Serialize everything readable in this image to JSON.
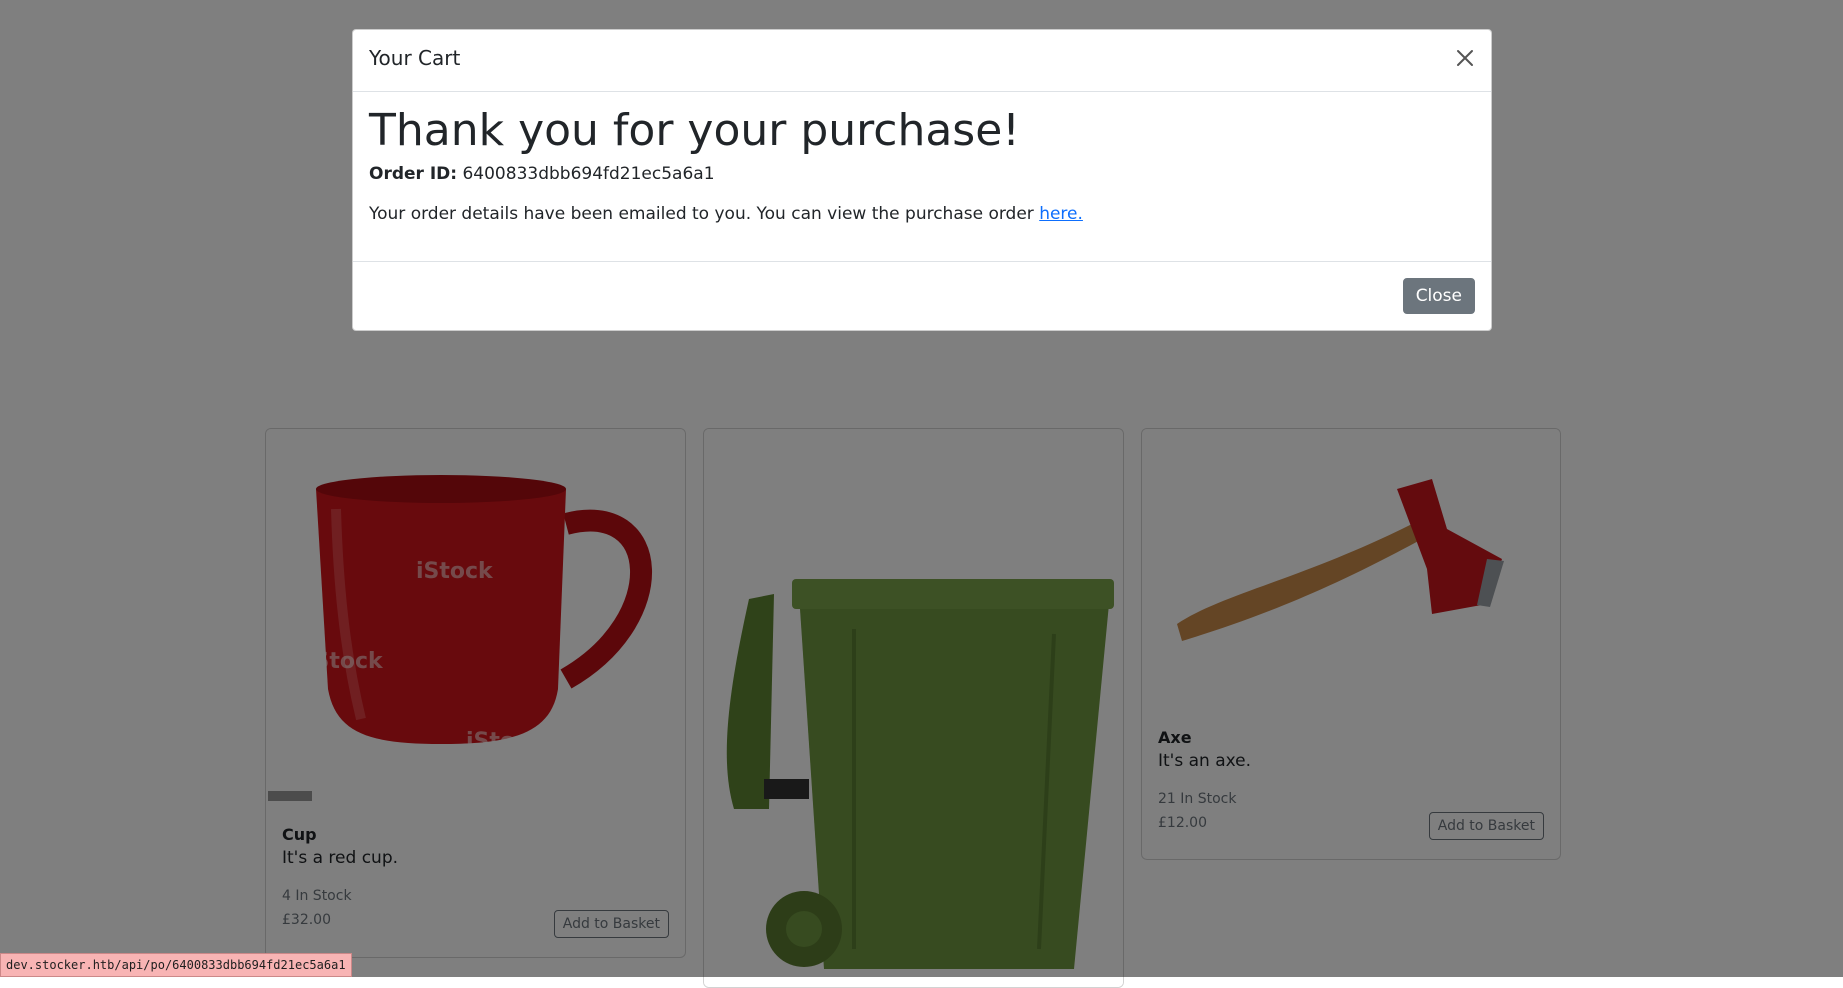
{
  "products": [
    {
      "name": "Cup",
      "description": "It's a red cup.",
      "stock": "4 In Stock",
      "price": "£32.00",
      "button_label": "Add to Basket",
      "watermark": "iStock"
    },
    {
      "name": "Bin",
      "image_alt": "green wheelie bin"
    },
    {
      "name": "Axe",
      "description": "It's an axe.",
      "stock": "21 In Stock",
      "price": "£12.00",
      "button_label": "Add to Basket"
    }
  ],
  "modal": {
    "title": "Your Cart",
    "heading": "Thank you for your purchase!",
    "order_label": "Order ID:",
    "order_id": "6400833dbb694fd21ec5a6a1",
    "details_text": "Your order details have been emailed to you. You can view the purchase order",
    "link_text": "here.",
    "close_label": "Close"
  },
  "status_bar": {
    "url": "dev.stocker.htb/api/po/6400833dbb694fd21ec5a6a1"
  },
  "colors": {
    "backdrop": "#000000",
    "primary_link": "#0d6efd",
    "secondary_button": "#6c757d",
    "cup_red": "#d0141a",
    "bin_green": "#6b8f3a",
    "axe_red": "#c8161d",
    "axe_handle": "#c98a4b"
  }
}
